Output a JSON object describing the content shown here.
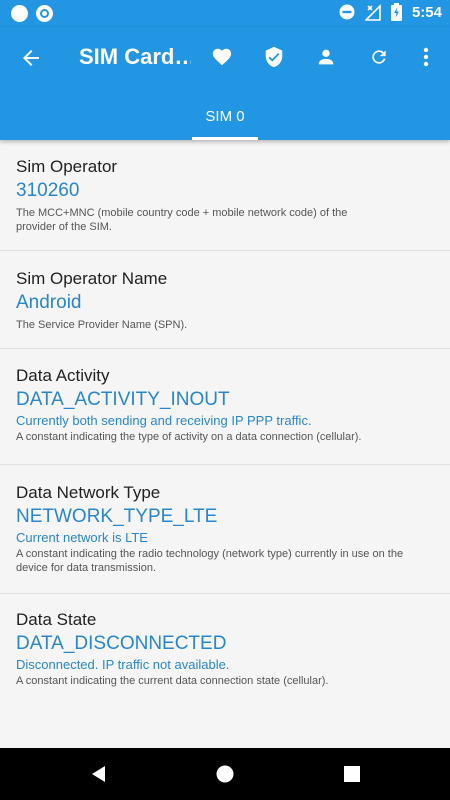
{
  "status_bar": {
    "time": "5:54"
  },
  "app_bar": {
    "title": "SIM Card…",
    "tab_label": "SIM 0"
  },
  "items": [
    {
      "title": "Sim Operator",
      "value": "310260",
      "subtitle": "",
      "description": "The MCC+MNC (mobile country code + mobile network code) of the provider of the SIM."
    },
    {
      "title": "Sim Operator Name",
      "value": "Android",
      "subtitle": "",
      "description": "The Service Provider Name (SPN)."
    },
    {
      "title": "Data Activity",
      "value": "DATA_ACTIVITY_INOUT",
      "subtitle": "Currently both sending and receiving IP PPP traffic.",
      "description": "A constant indicating the type of activity on a data connection (cellular)."
    },
    {
      "title": "Data Network Type",
      "value": "NETWORK_TYPE_LTE",
      "subtitle": "Current network is LTE",
      "description": "A constant indicating the radio technology (network type) currently in use on the device for data transmission."
    },
    {
      "title": "Data State",
      "value": "DATA_DISCONNECTED",
      "subtitle": "Disconnected. IP traffic not available.",
      "description": "A constant indicating the current data connection state (cellular)."
    }
  ],
  "icons": {
    "back": "arrow-back-icon",
    "favorite": "heart-icon",
    "verified": "shield-check-icon",
    "account": "person-icon",
    "refresh": "refresh-icon",
    "more": "more-vert-icon"
  },
  "colors": {
    "primary": "#2296e3",
    "value_text": "#2a86cc",
    "background": "#f5f5f5"
  }
}
